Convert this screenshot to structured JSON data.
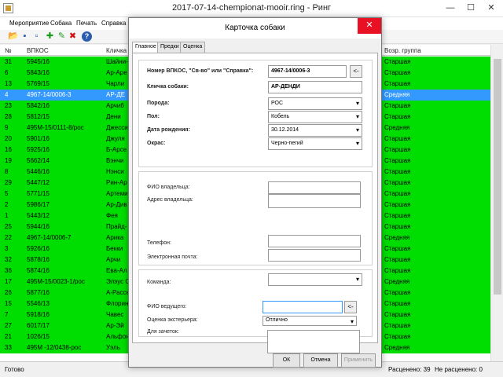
{
  "window": {
    "title": "2017-07-14-chempionat-mooir.ring - Ринг",
    "minimize": "—",
    "maximize": "☐",
    "close": "✕"
  },
  "menu": [
    "Мероприятие",
    "Собака",
    "Печать",
    "Справка"
  ],
  "toolbar": {
    "icons": [
      "open-folder-icon",
      "save-icon",
      "new-document-icon",
      "add-icon",
      "edit-icon",
      "delete-icon",
      "help-icon"
    ],
    "glyphs": [
      "📂",
      "▪",
      "▫",
      "✚",
      "✎",
      "✖",
      "?"
    ]
  },
  "grid": {
    "headers": {
      "num": "№",
      "vpkos": "ВПКОС",
      "name": "Кличка",
      "age_group": "Возр. группа"
    },
    "rows": [
      {
        "num": "31",
        "vpkos": "5945/16",
        "name": "Шайни-",
        "group": "Старшая"
      },
      {
        "num": "6",
        "vpkos": "5843/16",
        "name": "Ар-Аре",
        "group": "Старшая"
      },
      {
        "num": "13",
        "vpkos": "5769/15",
        "name": "Чарли",
        "group": "Старшая"
      },
      {
        "num": "4",
        "vpkos": "4967-14/0006-3",
        "name": "АР-ДЕ",
        "group": "Средняя",
        "selected": true
      },
      {
        "num": "23",
        "vpkos": "5842/16",
        "name": "Арчиб",
        "group": "Старшая"
      },
      {
        "num": "28",
        "vpkos": "5812/15",
        "name": "Дени",
        "group": "Старшая"
      },
      {
        "num": "9",
        "vpkos": "495М-15/0111-8/рос",
        "name": "Джесси",
        "group": "Средняя"
      },
      {
        "num": "20",
        "vpkos": "5901/16",
        "name": "Джуля",
        "group": "Старшая"
      },
      {
        "num": "16",
        "vpkos": "5925/16",
        "name": "Б-Арсе",
        "group": "Старшая"
      },
      {
        "num": "19",
        "vpkos": "5662/14",
        "name": "Вэнчи",
        "group": "Старшая"
      },
      {
        "num": "8",
        "vpkos": "5446/16",
        "name": "Нэнси",
        "group": "Старшая"
      },
      {
        "num": "29",
        "vpkos": "5447/12",
        "name": "Рин-Ар",
        "group": "Старшая"
      },
      {
        "num": "5",
        "vpkos": "5771/15",
        "name": "Артеми",
        "group": "Старшая"
      },
      {
        "num": "2",
        "vpkos": "5986/17",
        "name": "Ар-Див",
        "group": "Старшая"
      },
      {
        "num": "1",
        "vpkos": "5443/12",
        "name": "Фея",
        "group": "Старшая"
      },
      {
        "num": "25",
        "vpkos": "5944/16",
        "name": "Прайд-",
        "group": "Старшая"
      },
      {
        "num": "22",
        "vpkos": "4967-14/0006-7",
        "name": "Арика",
        "group": "Средняя"
      },
      {
        "num": "3",
        "vpkos": "5926/16",
        "name": "Бекки",
        "group": "Старшая"
      },
      {
        "num": "32",
        "vpkos": "5878/16",
        "name": "Арчи",
        "group": "Старшая"
      },
      {
        "num": "36",
        "vpkos": "5874/16",
        "name": "Ева-Ал",
        "group": "Старшая"
      },
      {
        "num": "17",
        "vpkos": "495М-15/0023-1/рос",
        "name": "Элэус С",
        "group": "Средняя"
      },
      {
        "num": "26",
        "vpkos": "5877/16",
        "name": "А-Рассе",
        "group": "Старшая"
      },
      {
        "num": "15",
        "vpkos": "5546/13",
        "name": "Флорин",
        "group": "Старшая"
      },
      {
        "num": "7",
        "vpkos": "5918/16",
        "name": "Чавес",
        "group": "Старшая"
      },
      {
        "num": "27",
        "vpkos": "6017/17",
        "name": "Ар-Эй",
        "group": "Старшая"
      },
      {
        "num": "21",
        "vpkos": "1026/15",
        "name": "Альфон",
        "group": "Старшая"
      },
      {
        "num": "33",
        "vpkos": "495М -12/0438-рос",
        "name": "Уэль",
        "group": "Средняя"
      }
    ]
  },
  "status": {
    "ready": "Готово",
    "distributed": "Расценено: 39",
    "not_distributed": "Не расценено: 0"
  },
  "dialog": {
    "title": "Карточка собаки",
    "close": "✕",
    "tabs": [
      "Главное",
      "Предки",
      "Оценка"
    ],
    "fields": {
      "vpkos_label": "Номер ВПКОС, \"Св-во\" или \"Справка\":",
      "vpkos_value": "4967-14/0006-3",
      "vpkos_btn": "<-",
      "name_label": "Кличка собаки:",
      "name_value": "АР-ДЕНДИ",
      "breed_label": "Порода:",
      "breed_value": "РОС",
      "sex_label": "Пол:",
      "sex_value": "Кобель",
      "dob_label": "Дата рождения:",
      "dob_value": "30.12.2014",
      "color_label": "Окрас:",
      "color_value": "Черно-пегий",
      "owner_name_label": "ФИО владельца:",
      "owner_addr_label": "Адрес владельца:",
      "phone_label": "Телефон:",
      "email_label": "Электронная почта:",
      "team_label": "Команда:",
      "handler_label": "ФИО ведущего:",
      "handler_btn": "<-",
      "exterior_label": "Оценка экстерьера:",
      "exterior_value": "Отлично",
      "notes_label": "Для зачеток:"
    },
    "buttons": {
      "ok": "ОК",
      "cancel": "Отмена",
      "apply": "Применить"
    }
  }
}
